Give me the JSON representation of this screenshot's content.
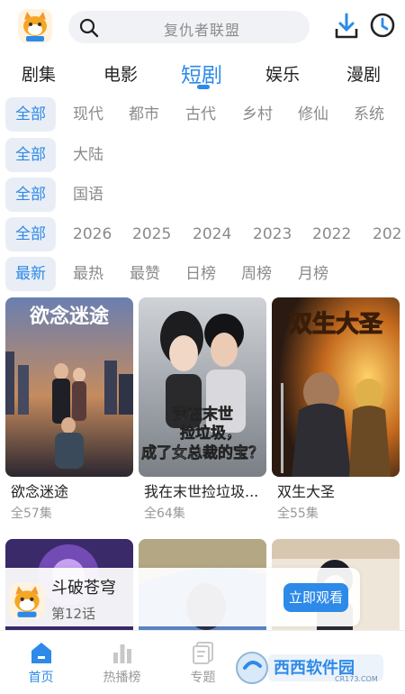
{
  "search": {
    "placeholder": "复仇者联盟"
  },
  "categories": [
    "剧集",
    "电影",
    "短剧",
    "娱乐",
    "漫剧"
  ],
  "active_category": "短剧",
  "filters": {
    "genre": [
      "全部",
      "现代",
      "都市",
      "古代",
      "乡村",
      "修仙",
      "系统"
    ],
    "region": [
      "全部",
      "大陆"
    ],
    "language": [
      "全部",
      "国语"
    ],
    "year": [
      "全部",
      "2026",
      "2025",
      "2024",
      "2023",
      "2022",
      "202"
    ],
    "sort": [
      "最新",
      "最热",
      "最赞",
      "日榜",
      "周榜",
      "月榜"
    ]
  },
  "cards": [
    {
      "title": "欲念迷途",
      "episodes": "全57集",
      "poster_text": "欲念迷途"
    },
    {
      "title": "我在末世捡垃圾...",
      "episodes": "全64集",
      "poster_text": "我在末世 捡垃圾， 成了女总裁的宝？"
    },
    {
      "title": "双生大圣",
      "episodes": "全55集",
      "poster_text": "双生大圣"
    }
  ],
  "banner": {
    "title": "斗破苍穹",
    "episode": "第12话",
    "button": "立即观看"
  },
  "tabs": [
    "首页",
    "热播榜",
    "专题"
  ],
  "watermark": {
    "text": "西西软件园",
    "sub": "CR173.COM"
  },
  "colors": {
    "accent": "#2d8ae8"
  },
  "icons": {
    "search": "search-icon",
    "download": "download-icon",
    "history": "history-icon"
  }
}
